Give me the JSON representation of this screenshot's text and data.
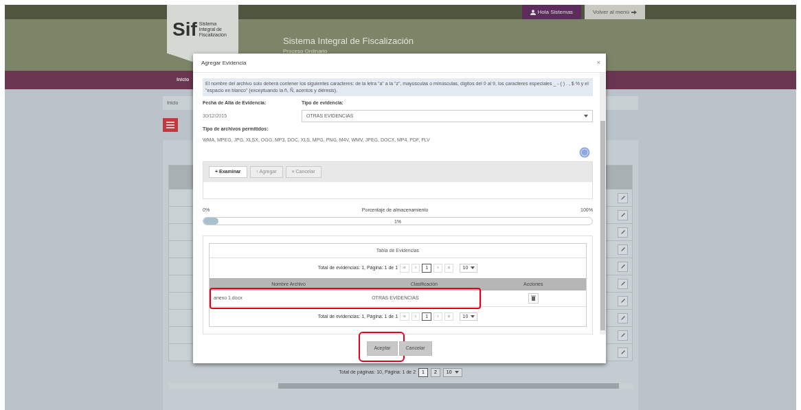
{
  "topbar": {
    "user_button": "Hola Sistemas",
    "back_button": "Volver al menú"
  },
  "header": {
    "logo_letters": "Sif",
    "logo_text": "Sistema Integral de Fiscalización",
    "title": "Sistema Integral de Fiscalización",
    "subtitle": "Proceso Ordinario"
  },
  "navbar": {
    "items": [
      "Inicio"
    ]
  },
  "breadcrumb": [
    "Inicio"
  ],
  "background_pager": {
    "summary": "Total de páginas: 10, Página: 1 de 2",
    "pages": [
      {
        "label": "1",
        "selected": true
      },
      {
        "label": "2",
        "selected": false
      }
    ],
    "page_size": "10"
  },
  "modal": {
    "title": "Agregar Evidencia",
    "close": "×",
    "notice": "El nombre del archivo solo deberá contener los siguientes caracteres: de la letra \"a\" a la \"z\", mayúsculas o minúsculas, dígitos del 0 al 9, los caracteres especiales _ - ( ) . , $ % y el \"espacio en blanco\" (exceptuando la ñ, Ñ, acentos y diéresis).",
    "date_label": "Fecha de Alta de Evidencia:",
    "date_value": "30/12/2015",
    "type_label": "Tipo de evidencia:",
    "type_value": "OTRAS EVIDENCIAS",
    "file_types_label": "Tipo de archivos permitidos:",
    "file_types": "WMA, MPEG, JPG, XLSX, OGG, MP3, DOC, XLS, MPG, PNG, M4V, WMV, JPEG, DOCX, MP4, PDF, FLV",
    "upload_buttons": [
      {
        "icon": "+",
        "label": "Examinar",
        "disabled": false
      },
      {
        "icon": "↑",
        "label": "Agregar",
        "disabled": true
      },
      {
        "icon": "×",
        "label": "Cancelar",
        "disabled": true
      }
    ],
    "storage": {
      "min": "0%",
      "label": "Porcentaje de almacenamiento",
      "max": "100%",
      "level": 0.01,
      "reading": "1%"
    },
    "evidence_table": {
      "title": "Tabla de Evidencias",
      "pager_top": {
        "summary": "Total de evidencias: 1, Página: 1 de 1",
        "first": "«",
        "prev": "‹",
        "pages": [
          {
            "label": "1",
            "selected": true
          }
        ],
        "next": "›",
        "last": "»",
        "page_size": "10"
      },
      "columns": [
        "Nombre Archivo",
        "Clasificación",
        "Acciones"
      ],
      "rows": [
        {
          "cells": [
            "anexo 1.docx",
            "OTRAS EVIDENCIAS"
          ],
          "highlighted": true
        }
      ],
      "pager_bottom": {
        "summary": "Total de evidencias: 1, Página: 1 de 1",
        "first": "«",
        "prev": "‹",
        "pages": [
          {
            "label": "1",
            "selected": true
          }
        ],
        "next": "›",
        "last": "»",
        "page_size": "10"
      }
    },
    "footer_buttons": [
      {
        "label": "Aceptar",
        "highlighted": true
      },
      {
        "label": "Cancelar",
        "highlighted": false
      }
    ]
  }
}
